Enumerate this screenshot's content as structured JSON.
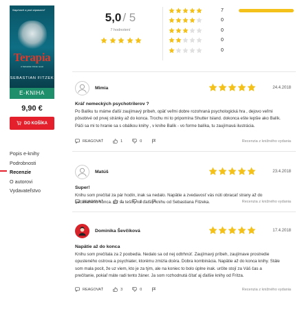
{
  "book": {
    "cover_quote": "Napínavé a pod zápasníci!",
    "cover_title": "Terapia",
    "cover_subtitle": "A Sebastian Fitzek novel",
    "cover_author": "SEBASTIAN FITZEK",
    "format_label": "E-KNIHA",
    "price": "9,90 €",
    "cart_label": "DO KOŠÍKA"
  },
  "nav": {
    "items": [
      "Popis e-knihy",
      "Podrobnosti",
      "Recenzie",
      "O autorovi",
      "Vydavateľstvo"
    ],
    "active_index": 2
  },
  "summary": {
    "score": "5,0",
    "scale": "/ 5",
    "count_text": "7 hodnotení",
    "stars": 5,
    "distribution": [
      {
        "stars": 5,
        "count": "7",
        "fraction": 1.0
      },
      {
        "stars": 4,
        "count": "0",
        "fraction": 0
      },
      {
        "stars": 3,
        "count": "0",
        "fraction": 0
      },
      {
        "stars": 2,
        "count": "0",
        "fraction": 0
      },
      {
        "stars": 1,
        "count": "0",
        "fraction": 0
      }
    ]
  },
  "reviews": [
    {
      "name": "Mimia",
      "rating": 5,
      "date": "24.4.2018",
      "title": "Kráľ nemeckých psychotrilerov ?",
      "text": "Po Balíku tu máme ďalší zaujímavý príbeh, opäť veľmi dobre rozohraná psychologická hra , dejovo veľmi pôsobivé od prvej stránky až do konca. Trochu mi to pripomína Shutter Island. dokonca ešte lepšie ako Balík. Páči sa mi to hranie sa s obálkou knihy , v knihe Balík - vo forme balíka, tu zaujímavá ilustrácia.",
      "reply_label": "REAGOVAŤ",
      "likes": "1",
      "dislikes": "0",
      "source": "Recenzia z knižného vydania",
      "avatar": "default"
    },
    {
      "name": "Matúš",
      "rating": 5,
      "date": "23.4.2018",
      "title": "Super!",
      "text": "Knihu som prečítal za pár hodín, inak sa nedalo. Napätie a zvedavosť vás núti obracať strany až do nečakaného konca. Už sa teším na ďalšiu knihu od Sebastiana Fitzeka.",
      "reply_label": "REAGOVAŤ",
      "likes": "1",
      "dislikes": "0",
      "source": "Recenzia z knižného vydania",
      "avatar": "default"
    },
    {
      "name": "Dominika Ševčíková",
      "rating": 5,
      "date": "17.4.2018",
      "title": "Napätie až do konca",
      "text": "Knihu som prečítala za 2 poobedia. Nedalo sa od nej odtrhnúť. Zaujímavý príbeh, zaujímave prostredie opusteného ostrova a psychiater, ktorému zmizla dcéra. Dobra kombinácia. Napätie až do konca knihy. Stále som mala pocit, že uz viem, kto je za tým, ale na koniec to bolo úplne inak. určite stojí za Váš čas a prečítanie, pokiaľ máte radi tento žáner. Ja som rozhodnutá čítať aj ďalšie knihy od Fritza.",
      "reply_label": "REAGOVAŤ",
      "likes": "3",
      "dislikes": "0",
      "source": "Recenzia z knižného vydania",
      "avatar": "red"
    }
  ],
  "colors": {
    "star": "#f3c11a",
    "star_empty": "#e0e0e0",
    "accent": "#e3202c"
  }
}
